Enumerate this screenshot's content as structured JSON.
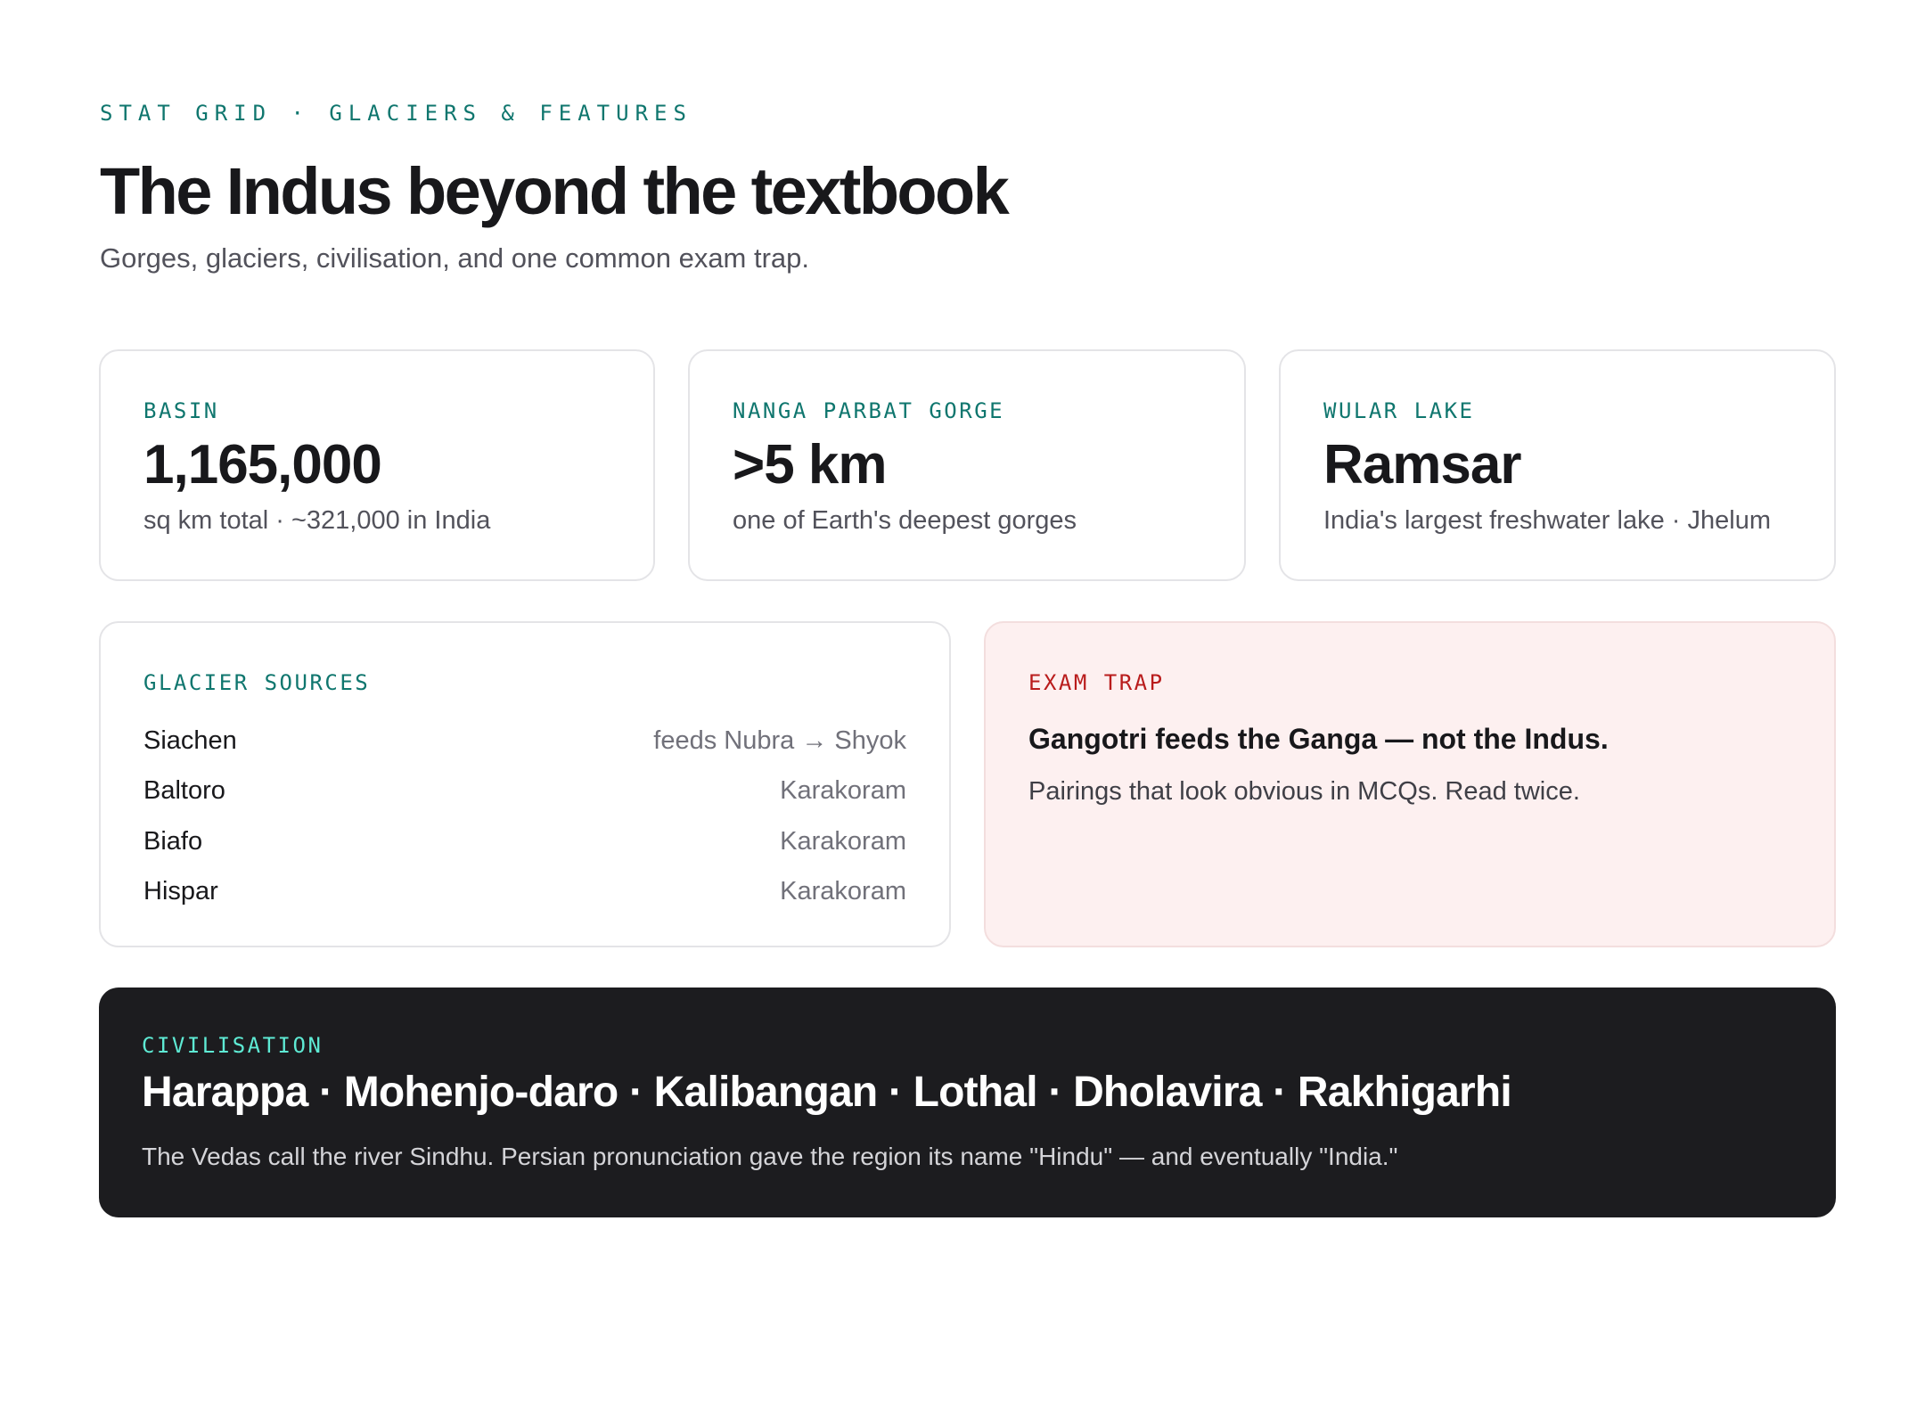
{
  "header": {
    "eyebrow": "STAT GRID · GLACIERS & FEATURES",
    "title": "The Indus beyond the textbook",
    "subtitle": "Gorges, glaciers, civilisation, and one common exam trap."
  },
  "stats": [
    {
      "label": "BASIN",
      "value": "1,165,000",
      "sub": "sq km total · ~321,000 in India"
    },
    {
      "label": "NANGA PARBAT GORGE",
      "value": ">5 km",
      "sub": "one of Earth's deepest gorges"
    },
    {
      "label": "WULAR LAKE",
      "value": "Ramsar",
      "sub": "India's largest freshwater lake · Jhelum"
    }
  ],
  "glaciers": {
    "label": "GLACIER SOURCES",
    "rows": [
      {
        "name": "Siachen",
        "note": "feeds Nubra → Shyok"
      },
      {
        "name": "Baltoro",
        "note": "Karakoram"
      },
      {
        "name": "Biafo",
        "note": "Karakoram"
      },
      {
        "name": "Hispar",
        "note": "Karakoram"
      }
    ]
  },
  "exam_trap": {
    "label": "EXAM TRAP",
    "title": "Gangotri feeds the Ganga — not the Indus.",
    "body": "Pairings that look obvious in MCQs. Read twice.",
    "accent_color": "#b91c1c",
    "background_color": "#fdf0f0"
  },
  "civilisation": {
    "label": "CIVILISATION",
    "sites": "Harappa · Mohenjo-daro · Kalibangan · Lothal · Dholavira · Rakhigarhi",
    "body": "The Vedas call the river Sindhu. Persian pronunciation gave the region its name \"Hindu\" — and eventually \"India.\"",
    "accent_color": "#5eead4",
    "background_color": "#1c1c1f"
  },
  "colors": {
    "accent": "#0f766e",
    "text": "#18181b",
    "muted": "#52525b",
    "border": "#e4e4e7"
  }
}
